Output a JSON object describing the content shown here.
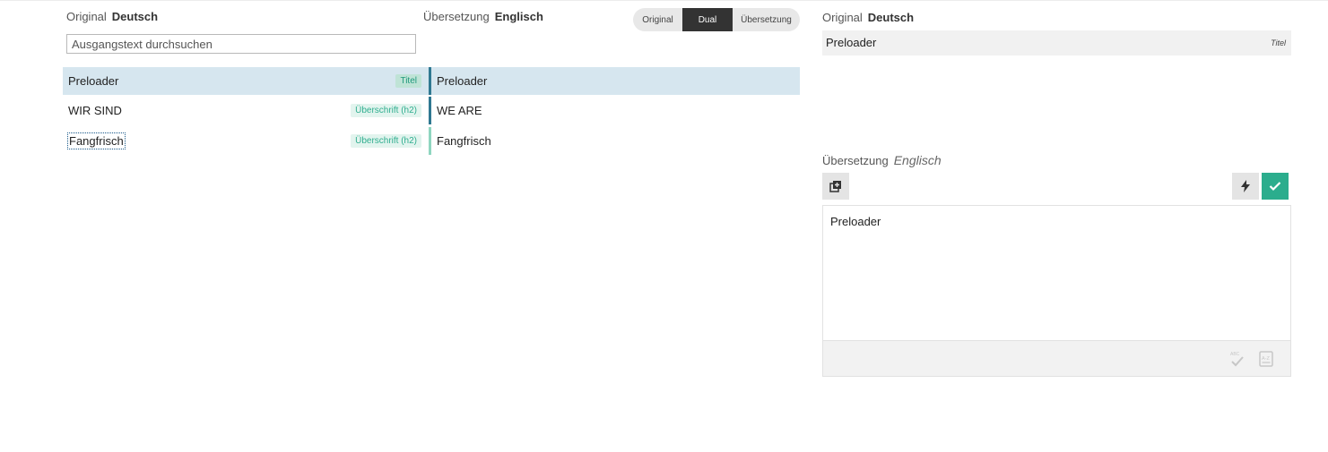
{
  "left_header": {
    "original_label": "Original",
    "original_lang": "Deutsch",
    "translation_label": "Übersetzung",
    "translation_lang": "Englisch"
  },
  "view_modes": [
    "Original",
    "Dual",
    "Übersetzung"
  ],
  "active_view_mode": "Dual",
  "search": {
    "placeholder": "Ausgangstext durchsuchen",
    "value": ""
  },
  "segments": [
    {
      "source": "Preloader",
      "tag": "Titel",
      "target": "Preloader",
      "selected": true
    },
    {
      "source": "WIR SIND",
      "tag": "Überschrift (h2)",
      "target": "WE ARE",
      "selected": false
    },
    {
      "source": "Fangfrisch",
      "tag": "Überschrift (h2)",
      "target": "Fangfrisch",
      "selected": false
    }
  ],
  "right_panel": {
    "original_label": "Original",
    "original_lang": "Deutsch",
    "original_text": "Preloader",
    "original_type": "Titel",
    "translation_label": "Übersetzung",
    "translation_lang": "Englisch",
    "translation_text": "Preloader"
  },
  "icons": {
    "copy": "copy-source-icon",
    "machine_translate": "lightning-icon",
    "confirm": "checkmark-icon",
    "spellcheck": "spellcheck-icon",
    "glossary": "glossary-az-icon"
  },
  "colors": {
    "accent_green": "#2bad8d",
    "selected_row": "#d6e6ef",
    "active_mode": "#333333",
    "tag_text": "#2fae8f"
  }
}
